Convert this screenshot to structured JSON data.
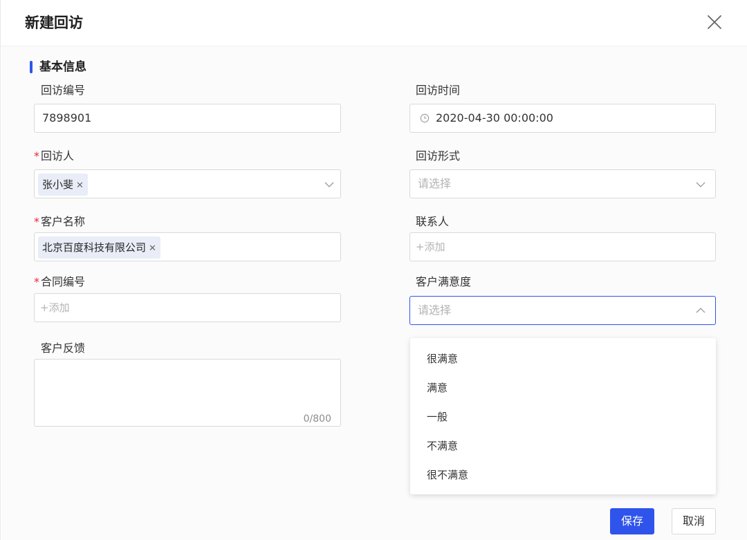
{
  "dialog": {
    "title": "新建回访",
    "section_title": "基本信息"
  },
  "fields": {
    "visit_no": {
      "label": "回访编号",
      "value": "7898901"
    },
    "visit_time": {
      "label": "回访时间",
      "value": "2020-04-30 00:00:00",
      "icon": "clock-icon"
    },
    "visitor": {
      "label": "回访人",
      "required_mark": "*",
      "tag": "张小斐",
      "tag_close": "✕"
    },
    "visit_form": {
      "label": "回访形式",
      "placeholder": "请选择"
    },
    "customer_name": {
      "label": "客户名称",
      "required_mark": "*",
      "tag": "北京百度科技有限公司",
      "tag_close": "✕"
    },
    "contact": {
      "label": "联系人",
      "placeholder": "+添加"
    },
    "contract_no": {
      "label": "合同编号",
      "required_mark": "*",
      "placeholder": "+添加"
    },
    "satisfaction": {
      "label": "客户满意度",
      "placeholder": "请选择"
    },
    "feedback": {
      "label": "客户反馈",
      "counter": "0/800"
    }
  },
  "satisfaction_options": [
    "很满意",
    "满意",
    "一般",
    "不满意",
    "很不满意"
  ],
  "buttons": {
    "save": "保存",
    "cancel": "取消"
  },
  "colors": {
    "accent": "#2f54eb",
    "required": "#f5222d"
  }
}
